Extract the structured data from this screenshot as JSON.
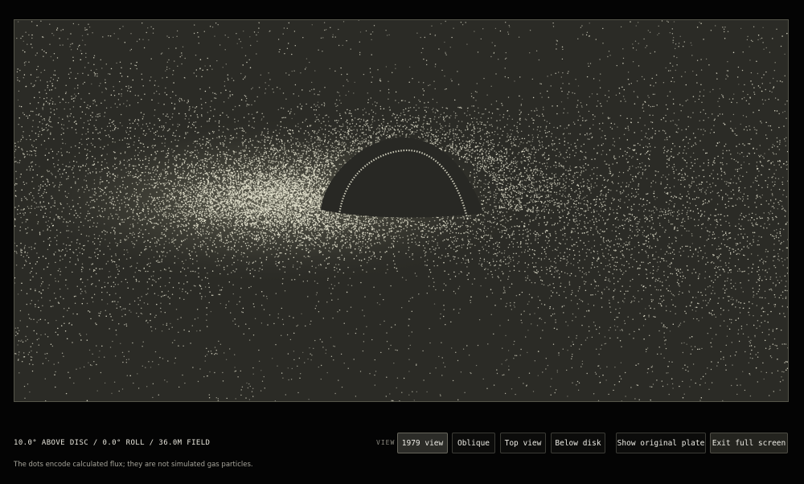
{
  "viewer": {
    "status_text": "10.0° ABOVE DISC / 0.0° ROLL / 36.0M FIELD",
    "footnote": "The dots encode calculated flux; they are not simulated gas particles."
  },
  "view_controls": {
    "label": "VIEW",
    "buttons": [
      {
        "label": "1979 view",
        "active": true
      },
      {
        "label": "Oblique",
        "active": false
      },
      {
        "label": "Top view",
        "active": false
      },
      {
        "label": "Below disk",
        "active": false
      }
    ]
  },
  "actions": {
    "show_original_plate": "Show original plate",
    "exit_full_screen": "Exit full screen"
  },
  "colors": {
    "plate_background": "#2b2b26",
    "dot": "#e8e6d2",
    "page_background": "#040404"
  }
}
